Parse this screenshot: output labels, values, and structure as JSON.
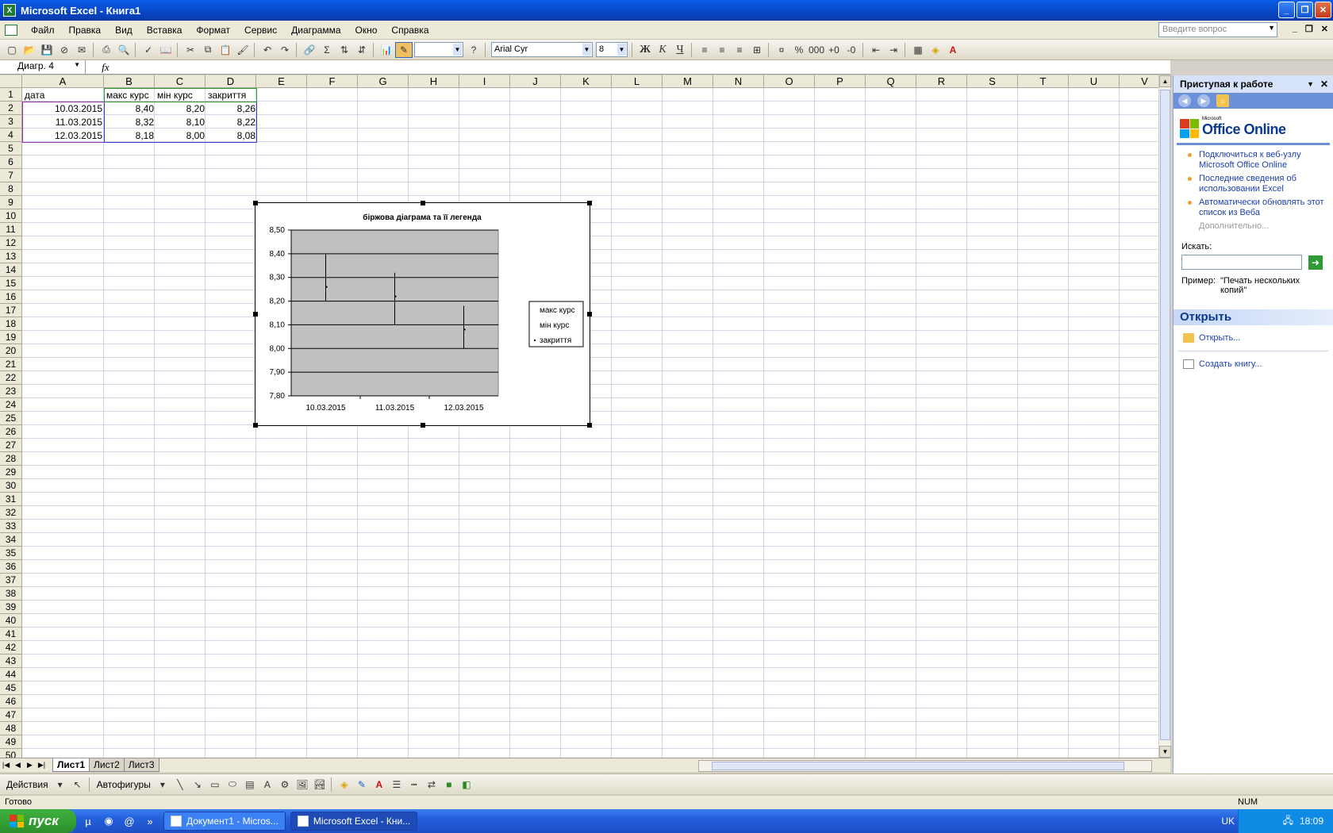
{
  "window": {
    "title": "Microsoft Excel - Книга1",
    "app_icon": "excel-icon"
  },
  "menu": [
    "Файл",
    "Правка",
    "Вид",
    "Вставка",
    "Формат",
    "Сервис",
    "Диаграмма",
    "Окно",
    "Справка"
  ],
  "help_search": {
    "placeholder": "Введите вопрос"
  },
  "toolbar": {
    "font": "Arial Cyr",
    "size": "8",
    "bold": "Ж",
    "italic": "К",
    "underline": "Ч"
  },
  "formula_bar": {
    "name_box": "Диагр. 4",
    "fx": "fx",
    "content": ""
  },
  "columns": [
    "A",
    "B",
    "C",
    "D",
    "E",
    "F",
    "G",
    "H",
    "I",
    "J",
    "K",
    "L",
    "M",
    "N",
    "O",
    "P",
    "Q",
    "R",
    "S",
    "T",
    "U",
    "V"
  ],
  "rows_count": 50,
  "cells": {
    "header": [
      "дата",
      "макс курс",
      "мін курс",
      "закриття"
    ],
    "data": [
      [
        "10.03.2015",
        "8,40",
        "8,20",
        "8,26"
      ],
      [
        "11.03.2015",
        "8,32",
        "8,10",
        "8,22"
      ],
      [
        "12.03.2015",
        "8,18",
        "8,00",
        "8,08"
      ]
    ]
  },
  "chart_data": {
    "type": "stock",
    "title": "біржова діаграма та її легенда",
    "categories": [
      "10.03.2015",
      "11.03.2015",
      "12.03.2015"
    ],
    "series": [
      {
        "name": "макс курс",
        "values": [
          8.4,
          8.32,
          8.18
        ]
      },
      {
        "name": "мін курс",
        "values": [
          8.2,
          8.1,
          8.0
        ]
      },
      {
        "name": "закриття",
        "values": [
          8.26,
          8.22,
          8.08
        ]
      }
    ],
    "ylim": [
      7.8,
      8.5
    ],
    "yticks": [
      "7,80",
      "7,90",
      "8,00",
      "8,10",
      "8,20",
      "8,30",
      "8,40",
      "8,50"
    ],
    "grid": true,
    "plot_background": "#c0c0c0",
    "legend_position": "right"
  },
  "sheets": [
    "Лист1",
    "Лист2",
    "Лист3"
  ],
  "active_sheet": "Лист1",
  "drawing_toolbar": {
    "actions": "Действия",
    "autoshapes": "Автофигуры"
  },
  "status": {
    "text": "Готово",
    "num": "NUM"
  },
  "task_pane": {
    "title": "Приступая к работе",
    "logo_small": "Microsoft",
    "logo": "Office Online",
    "links": [
      "Подключиться к веб-узлу Microsoft Office Online",
      "Последние сведения об использовании Excel",
      "Автоматически обновлять этот список из Веба"
    ],
    "more": "Дополнительно...",
    "search_label": "Искать:",
    "example_label": "Пример:",
    "example_text": "\"Печать нескольких копий\"",
    "open_section": "Открыть",
    "open_link": "Открыть...",
    "create_link": "Создать книгу..."
  },
  "taskbar": {
    "start": "пуск",
    "buttons": [
      "Документ1 - Micros...",
      "Microsoft Excel - Кни..."
    ],
    "lang": "UK",
    "time": "18:09"
  }
}
